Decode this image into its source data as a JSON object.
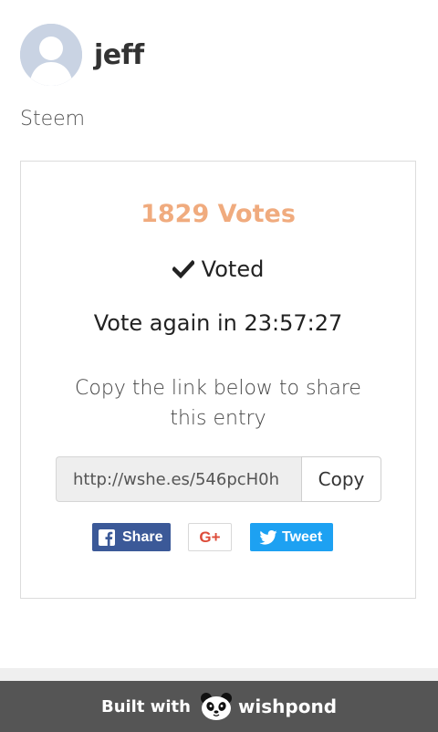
{
  "profile": {
    "name": "jeff",
    "subtitle": "Steem"
  },
  "card": {
    "votes_text": "1829 Votes",
    "voted_label": "Voted",
    "vote_again_text": "Vote again in 23:57:27",
    "share_instruction": "Copy the link below to share this entry",
    "share_link": "http://wshe.es/546pcH0h",
    "copy_label": "Copy"
  },
  "social": {
    "facebook_label": "Share",
    "googleplus_label": "G+",
    "twitter_label": "Tweet"
  },
  "footer": {
    "built_with": "Built with",
    "brand": "wishpond"
  },
  "colors": {
    "votes_accent": "#f0ab7e",
    "facebook": "#3b5998",
    "twitter": "#1da1f2",
    "googleplus": "#dd4b39",
    "footer_bg": "#555555"
  },
  "icons": {
    "avatar": "default-user-avatar-icon",
    "voted": "checkmark-icon",
    "facebook": "facebook-icon",
    "twitter": "twitter-bird-icon",
    "brand": "panda-logo-icon"
  }
}
